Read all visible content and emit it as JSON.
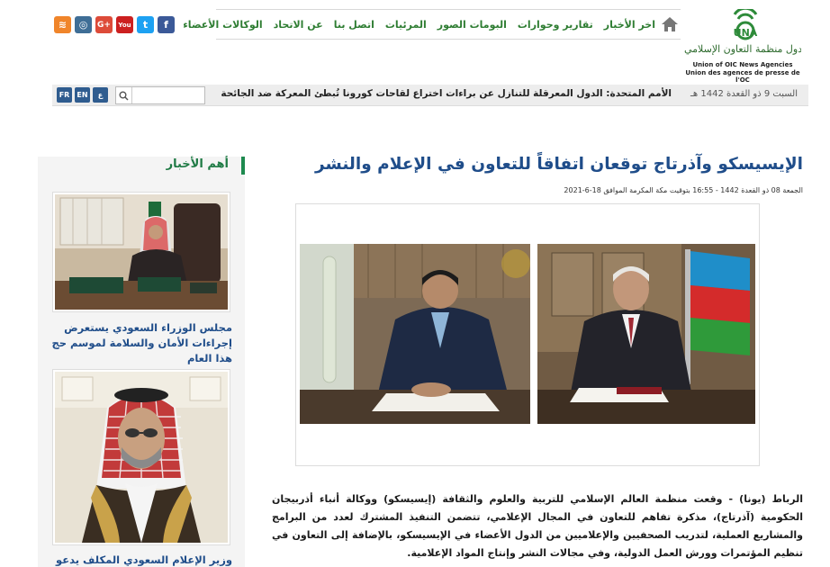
{
  "logo": {
    "mark": "UNA",
    "arabic": "اتحاد وكالات أنباء دول منظمة التعاون الإسلامي",
    "english": "Union of OIC News Agencies",
    "french": "Union des agences de presse de l'OC"
  },
  "nav": {
    "items": [
      "اخر الأخبار",
      "تقارير وحوارات",
      "البومات الصور",
      "المرئيات",
      "اتصل بنا",
      "عن الاتحاد",
      "الوكالات الأعضاء"
    ],
    "more": "»"
  },
  "social": [
    {
      "name": "facebook",
      "glyph": "f",
      "color": "#3b5998"
    },
    {
      "name": "twitter",
      "glyph": "t",
      "color": "#1da1f2"
    },
    {
      "name": "youtube",
      "glyph": "You",
      "color": "#cc2020"
    },
    {
      "name": "google-plus",
      "glyph": "G+",
      "color": "#dd4b39"
    },
    {
      "name": "instagram",
      "glyph": "◎",
      "color": "#3f6e96"
    },
    {
      "name": "rss",
      "glyph": "≋",
      "color": "#f0852a"
    }
  ],
  "ticker": {
    "date": "السبت 9 ذو القعدة 1442 هـ",
    "headline": "الأمم المتحدة: الدول المعرقلة للتنازل عن براءات اختراع لقاحات كورونا تُبطئ المعركة ضد الجائحة"
  },
  "search": {
    "placeholder": ""
  },
  "languages": [
    "ع",
    "EN",
    "FR"
  ],
  "sidebar": {
    "title": "أهم الأخبار",
    "cards": [
      {
        "caption": "مجلس الوزراء السعودي يستعرض إجراءات الأمان والسلامة لموسم حج هذا العام"
      },
      {
        "caption": "وزير الإعلام السعودي المكلف يدعو"
      }
    ]
  },
  "article": {
    "title": "الإيسيسكو وآذرتاج توقعان اتفاقاً للتعاون في الإعلام والنشر",
    "meta": "الجمعة 08 ذو القعدة 1442 - 16:55 بتوقيت مكة المكرمة الموافق 18-6-2021",
    "body": "الرباط (يونا) - وقعت منظمة العالم الإسلامي للتربية والعلوم والثقافة (إيسيسكو) ووكالة أنباء أذربيجان الحكومية (آذرتاج)، مذكرة تفاهم للتعاون في المجال الإعلامي، تتضمن التنفيذ المشترك لعدد من البرامج والمشاريع العملية، لتدريب الصحفيين والإعلاميين من الدول الأعضاء في الإيسيسكو، بالإضافة إلى التعاون في تنظيم المؤتمرات وورش العمل الدولية، وفي مجالات النشر وإنتاج المواد الإعلامية."
  },
  "colors": {
    "accent": "#2e7d32",
    "link": "#1f4d8a",
    "lang_button": "#2f5c8f",
    "sidebar_rule": "#1e8a4f"
  }
}
